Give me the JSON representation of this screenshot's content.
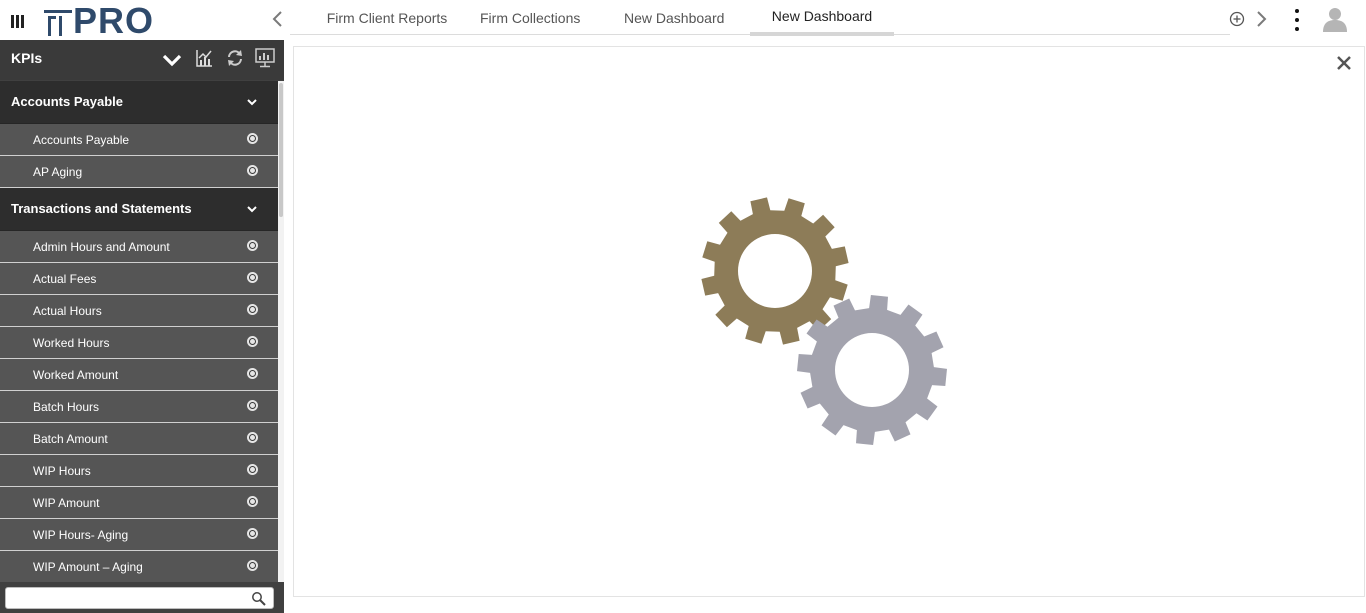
{
  "app": {
    "logo_text": "PRO"
  },
  "tabs": [
    {
      "label": "Firm Client Reports",
      "active": false
    },
    {
      "label": "Firm Collections",
      "active": false
    },
    {
      "label": "New Dashboard",
      "active": false
    },
    {
      "label": "New Dashboard",
      "active": true
    }
  ],
  "sidebar": {
    "title": "KPIs",
    "groups": [
      {
        "label": "Accounts Payable",
        "items": [
          "Accounts Payable",
          "AP Aging"
        ]
      },
      {
        "label": "Transactions and Statements",
        "items": [
          "Admin Hours and Amount",
          "Actual Fees",
          "Actual Hours",
          "Worked Hours",
          "Worked Amount",
          "Batch Hours",
          "Batch Amount",
          "WIP Hours",
          "WIP Amount",
          "WIP Hours- Aging",
          "WIP Amount – Aging"
        ]
      }
    ],
    "search": {
      "value": "",
      "placeholder": ""
    }
  },
  "colors": {
    "logo": "#2f4a6b",
    "sidebar_bg": "#404040",
    "group_bg": "#2d2d2d",
    "item_bg": "#555555",
    "gear_primary": "#8d7c58",
    "gear_secondary": "#a3a3ae"
  },
  "icons": {
    "menu": "hamburger-vertical-bars-icon",
    "collapse": "chevron-down-icon",
    "chart": "line-chart-icon",
    "refresh": "refresh-icon",
    "presentation": "monitor-chart-icon",
    "add_tab": "plus-circle-icon",
    "more": "kebab-menu-icon",
    "user": "user-avatar-icon",
    "close": "close-icon",
    "search": "search-icon",
    "loading": "gears-loading-icon"
  }
}
